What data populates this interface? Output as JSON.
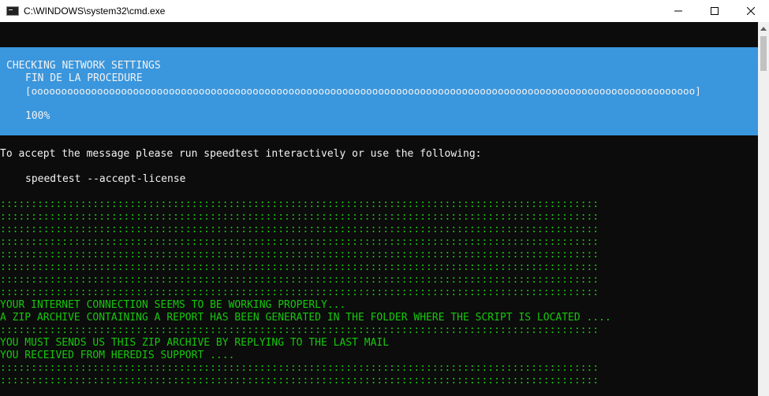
{
  "window": {
    "title": "C:\\WINDOWS\\system32\\cmd.exe",
    "colors": {
      "banner": "#3a96dd",
      "console_bg": "#0c0c0c",
      "green": "#16c60c",
      "text": "#f2f2f2"
    }
  },
  "banner": {
    "heading": "CHECKING NETWORK SETTINGS",
    "subheading": "FIN DE LA PROCEDURE",
    "progress_bar": "[ooooooooooooooooooooooooooooooooooooooooooooooooooooooooooooooooooooooooooooooooooooooooooooooooooooooooooooooo]",
    "percent": "100%"
  },
  "console": {
    "accept_message": "To accept the message please run speedtest interactively or use the following:",
    "command": "speedtest --accept-license",
    "separator": ":::::::::::::::::::::::::::::::::::::::::::::::::::::::::::::::::::::::::::::::::::::::::::::::::",
    "msg_working": "YOUR INTERNET CONNECTION SEEMS TO BE WORKING PROPERLY...",
    "msg_zip": "A ZIP ARCHIVE CONTAINING A REPORT HAS BEEN GENERATED IN THE FOLDER WHERE THE SCRIPT IS LOCATED ....",
    "msg_send": "YOU MUST SENDS US THIS ZIP ARCHIVE BY REPLYING TO THE LAST MAIL",
    "msg_support": "YOU RECEIVED FROM HEREDIS SUPPORT ...."
  }
}
